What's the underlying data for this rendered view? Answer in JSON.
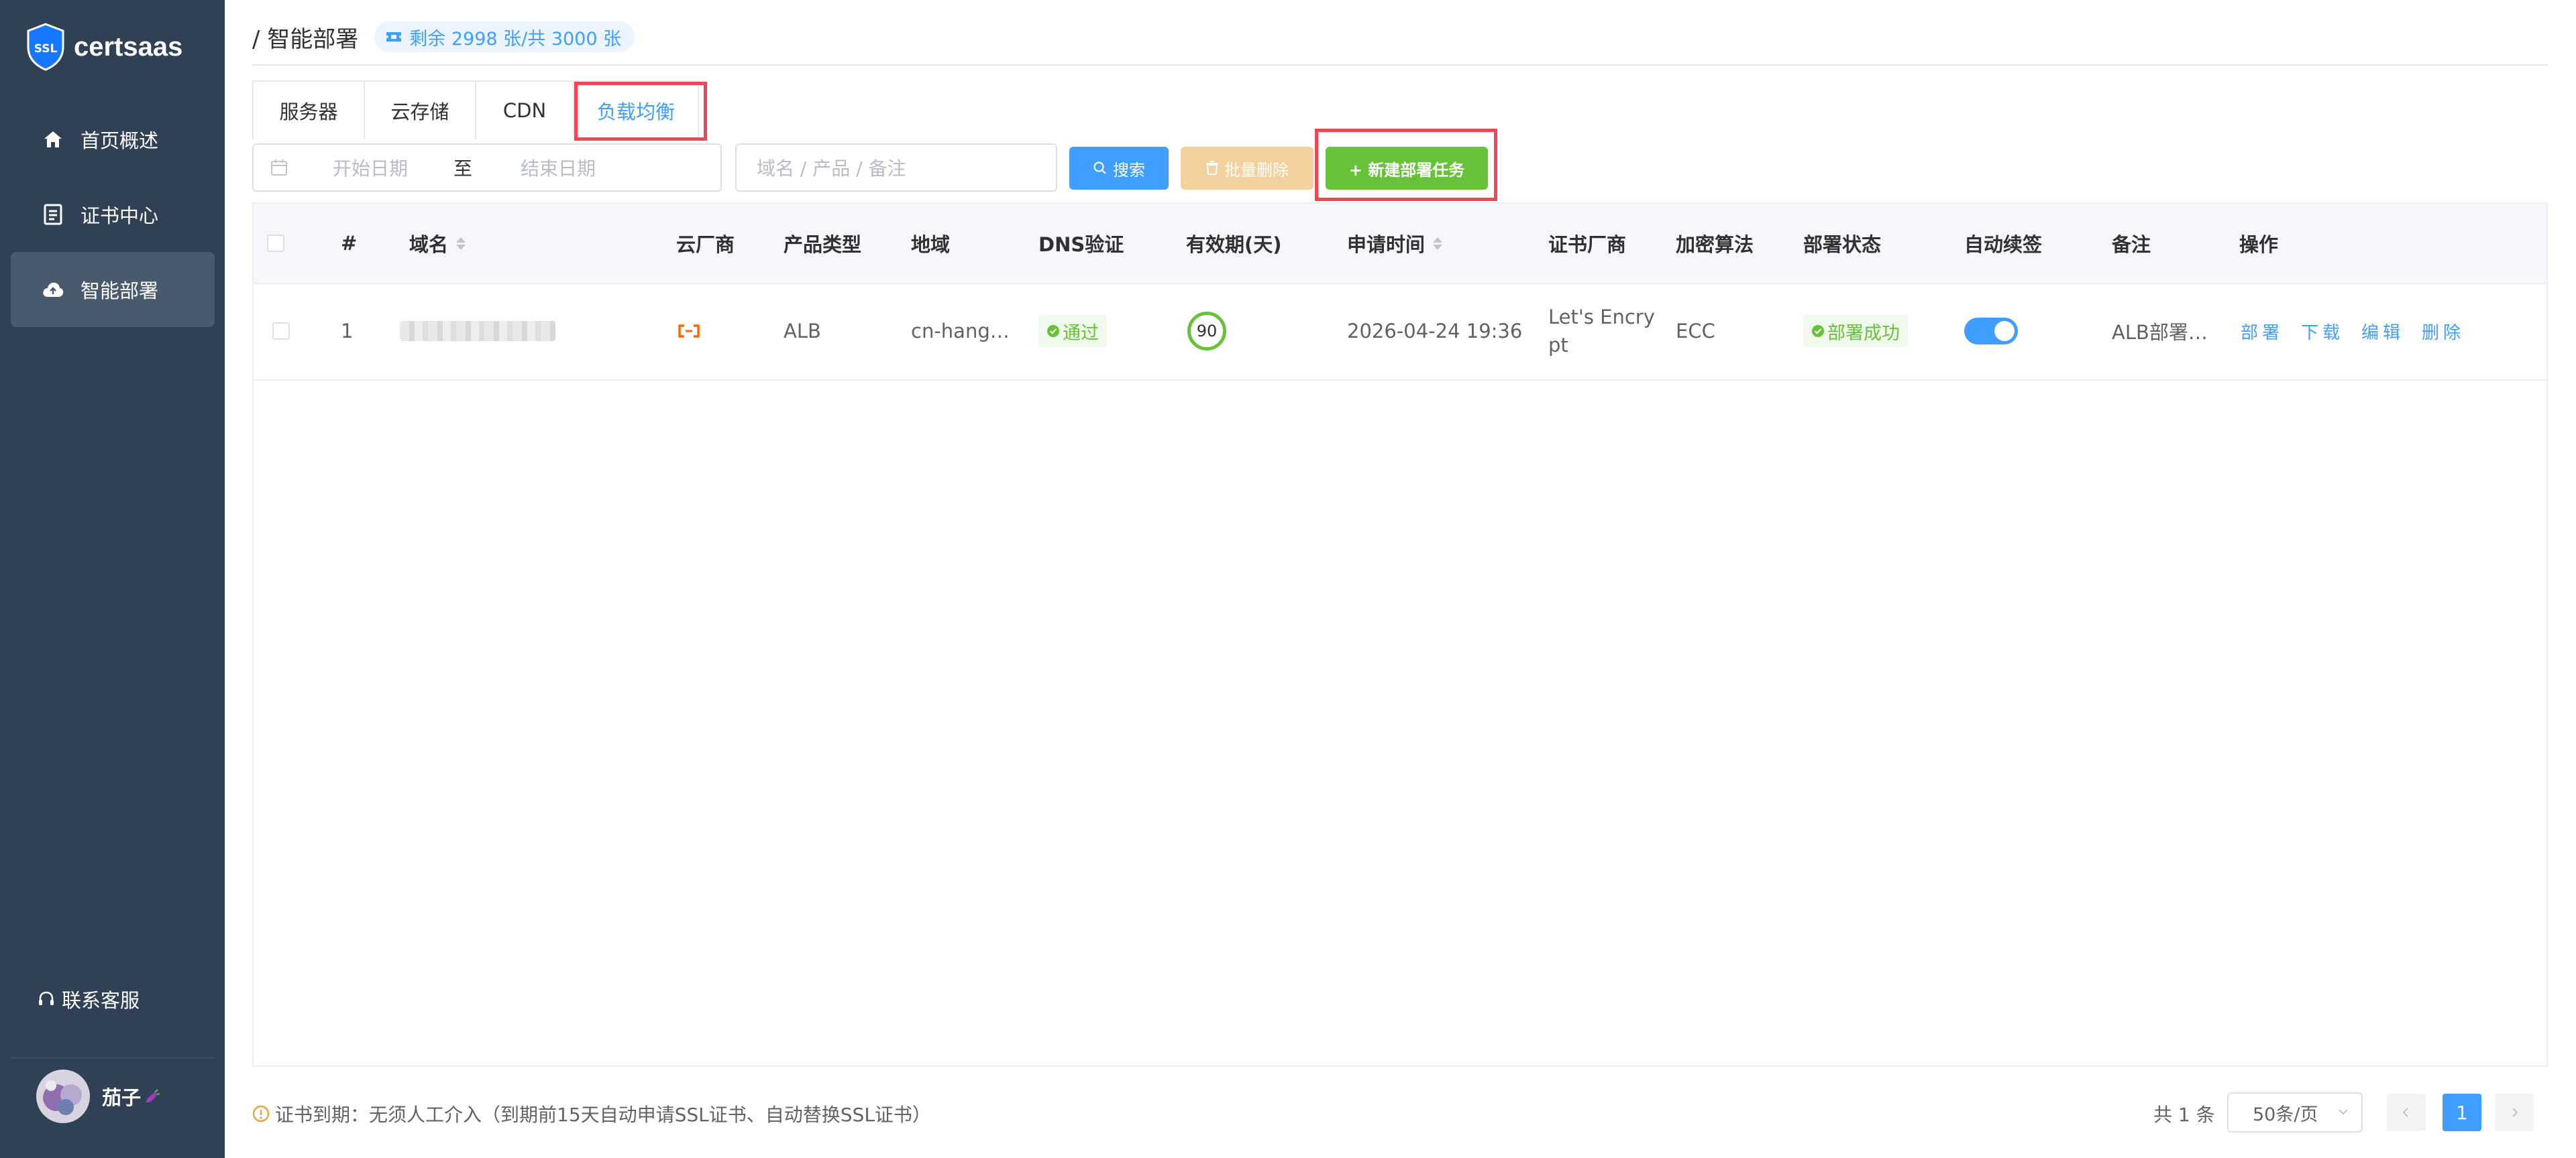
{
  "app": {
    "name": "certsaas",
    "logo_text": "SSL"
  },
  "sidebar": {
    "items": [
      {
        "label": "首页概述",
        "icon": "home-icon"
      },
      {
        "label": "证书中心",
        "icon": "document-icon"
      },
      {
        "label": "智能部署",
        "icon": "cloud-upload-icon",
        "active": true
      }
    ],
    "support_label": "联系客服",
    "user_name": "茄子"
  },
  "header": {
    "breadcrumb": "/ 智能部署",
    "quota": "剩余 2998 张/共 3000 张"
  },
  "tabs": [
    {
      "label": "服务器"
    },
    {
      "label": "云存储"
    },
    {
      "label": "CDN"
    },
    {
      "label": "负载均衡",
      "active": true
    }
  ],
  "toolbar": {
    "date_start_placeholder": "开始日期",
    "date_separator": "至",
    "date_end_placeholder": "结束日期",
    "search_placeholder": "域名 / 产品 / 备注",
    "search_button": "搜索",
    "batch_delete_button": "批量删除",
    "new_task_button": "+ 新建部署任务"
  },
  "table": {
    "columns": [
      "#",
      "域名",
      "云厂商",
      "产品类型",
      "地域",
      "DNS验证",
      "有效期(天)",
      "申请时间",
      "证书厂商",
      "加密算法",
      "部署状态",
      "自动续签",
      "备注",
      "操作"
    ],
    "rows": [
      {
        "index": "1",
        "domain": "",
        "cloud_vendor_icon": "aliyun-icon",
        "product_type": "ALB",
        "region": "cn-hang…",
        "dns_verify": "通过",
        "validity_days": "90",
        "apply_time": "2026-04-24 19:36",
        "cert_vendor_line1": "Let's Encry",
        "cert_vendor_line2": "pt",
        "algorithm": "ECC",
        "deploy_status": "部署成功",
        "auto_renew": true,
        "remark": "ALB部署…",
        "actions": [
          "部署",
          "下载",
          "编辑",
          "删除"
        ]
      }
    ]
  },
  "footer": {
    "expiry_note": "证书到期：无须人工介入（到期前15天自动申请SSL证书、自动替换SSL证书）",
    "total": "共 1 条",
    "page_size": "50条/页",
    "current_page": "1"
  },
  "colors": {
    "sidebar_bg": "#304156",
    "primary": "#409eff",
    "success": "#67c23a",
    "warning_light": "#f3d19e",
    "highlight_box": "#f04654"
  }
}
